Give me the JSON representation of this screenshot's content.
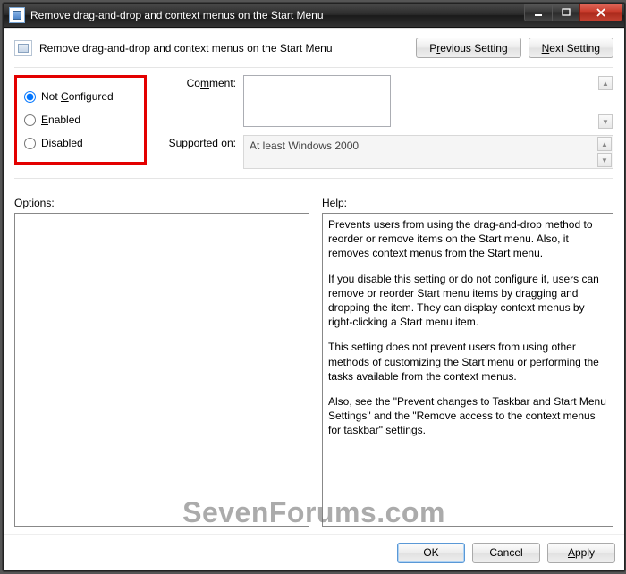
{
  "window": {
    "title": "Remove drag-and-drop and context menus on the Start Menu"
  },
  "header": {
    "policy_title": "Remove drag-and-drop and context menus on the Start Menu",
    "prev_pre": "P",
    "prev_u": "r",
    "prev_post": "evious Setting",
    "next_pre": "",
    "next_u": "N",
    "next_post": "ext Setting"
  },
  "state": {
    "not_configured_pre": "Not ",
    "not_configured_u": "C",
    "not_configured_post": "onfigured",
    "enabled_pre": "",
    "enabled_u": "E",
    "enabled_post": "nabled",
    "disabled_pre": "",
    "disabled_u": "D",
    "disabled_post": "isabled"
  },
  "labels": {
    "comment_pre": "Co",
    "comment_u": "m",
    "comment_post": "ment:",
    "supported": "Supported on:",
    "options": "Options:",
    "help": "Help:"
  },
  "values": {
    "comment": "",
    "supported_on": "At least Windows 2000"
  },
  "help": {
    "p1": "Prevents users from using the drag-and-drop method to reorder or remove items on the Start menu. Also, it removes context menus from the Start menu.",
    "p2": "If you disable this setting or do not configure it, users can remove or reorder Start menu items by dragging and dropping the item. They can display context menus by right-clicking a Start menu item.",
    "p3": "This setting does not prevent users from using other methods of customizing the Start menu or performing the tasks available from the context menus.",
    "p4": "Also, see the \"Prevent changes to Taskbar and Start Menu Settings\" and the \"Remove access to the context menus for taskbar\" settings."
  },
  "footer": {
    "ok": "OK",
    "cancel": "Cancel",
    "apply_pre": "",
    "apply_u": "A",
    "apply_post": "pply"
  },
  "watermark": "SevenForums.com"
}
